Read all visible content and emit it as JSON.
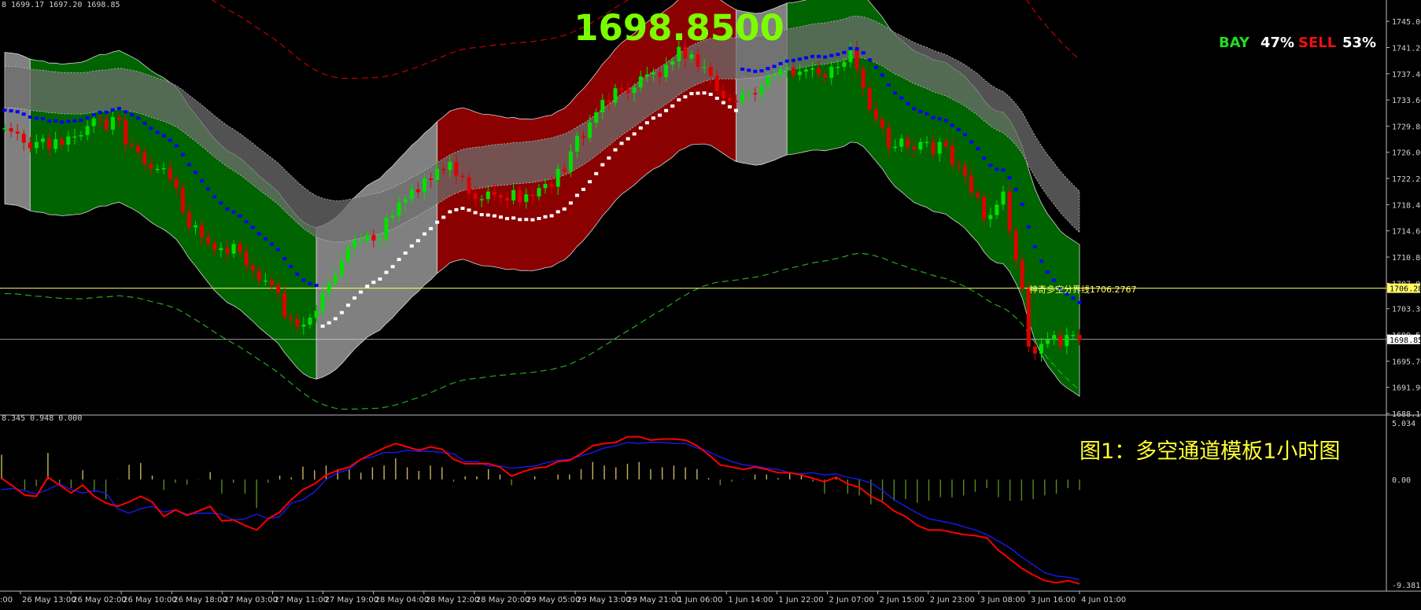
{
  "ohlc_header": "8 1699.17 1697.20 1698.85",
  "big_price": "1698.8500",
  "bay_label": "BAY",
  "bay_pct": "47%",
  "sell_label": "SELL",
  "sell_pct": "53%",
  "boundary_label": "神奇多空分界线1706.2767",
  "figure_caption": "图1：多空通道模板1小时图",
  "indicator_header": "8.345 0.948 0.000",
  "colors": {
    "bull_band": "#006400",
    "bear_band": "#8b0000",
    "neutral_band": "#808080",
    "up_candle": "#00e000",
    "down_candle": "#e00000",
    "trend_blue": "#0000ff",
    "trend_white": "#ffffff",
    "boundary_line": "#ffff66",
    "macd_red": "#ff0000",
    "macd_blue": "#1a1aff",
    "hist_pos": "#c8b464",
    "hist_neg": "#5a8a1e",
    "title_green": "#7cfc00",
    "caption_yellow": "#ffff33"
  },
  "chart_data": [
    {
      "type": "candlestick",
      "title": "1698.8500",
      "price_axis_ticks": [
        "1745.00",
        "1741.20",
        "1737.40",
        "1733.60",
        "1729.80",
        "1726.00",
        "1722.20",
        "1718.40",
        "1714.60",
        "1710.80",
        "1707.00",
        "1703.30",
        "1699.50",
        "1695.70",
        "1691.90",
        "1688.10"
      ],
      "price_markers": [
        {
          "label": "1706.28",
          "value": 1706.28
        },
        {
          "label": "1698.85",
          "value": 1698.85
        }
      ],
      "ylim": [
        1688.1,
        1746.5
      ],
      "time_axis_ticks": [
        "26 May 13:00",
        "26 May 02:00",
        "26 May 10:00",
        "26 May 18:00",
        "27 May 03:00",
        "27 May 11:00",
        "27 May 19:00",
        "28 May 04:00",
        "28 May 12:00",
        "28 May 20:00",
        "29 May 05:00",
        "29 May 13:00",
        "29 May 21:00",
        "1 Jun 06:00",
        "1 Jun 14:00",
        "1 Jun 22:00",
        "2 Jun 07:00",
        "2 Jun 15:00",
        "2 Jun 23:00",
        "3 Jun 08:00",
        "3 Jun 16:00",
        "4 Jun 01:00"
      ],
      "first_tick_partial": ":00",
      "close_series": [
        1729.5,
        1729.0,
        1728.7,
        1727.4,
        1726.6,
        1727.5,
        1728.0,
        1726.5,
        1727.9,
        1727.1,
        1728.3,
        1728.3,
        1728.5,
        1729.8,
        1730.9,
        1730.8,
        1729.3,
        1731.1,
        1730.7,
        1727.1,
        1726.9,
        1726.0,
        1724.3,
        1723.6,
        1723.6,
        1723.7,
        1722.1,
        1720.8,
        1717.3,
        1715.1,
        1715.4,
        1713.7,
        1712.8,
        1711.8,
        1712.1,
        1711.3,
        1712.7,
        1711.5,
        1709.6,
        1708.8,
        1707.4,
        1707.4,
        1706.7,
        1705.6,
        1702.1,
        1701.8,
        1700.7,
        1701.0,
        1702.0,
        1703.0,
        1705.6,
        1707.0,
        1708.2,
        1710.3,
        1712.2,
        1713.2,
        1713.2,
        1714.0,
        1713.2,
        1713.4,
        1716.5,
        1716.8,
        1718.7,
        1719.2,
        1720.6,
        1720.2,
        1722.2,
        1722.0,
        1723.6,
        1723.4,
        1724.6,
        1722.6,
        1722.4,
        1720.0,
        1719.2,
        1719.2,
        1720.3,
        1719.8,
        1719.4,
        1719.0,
        1720.5,
        1718.8,
        1719.9,
        1719.6,
        1720.8,
        1721.4,
        1721.0,
        1723.6,
        1723.2,
        1726.1,
        1728.4,
        1728.1,
        1730.3,
        1731.8,
        1733.6,
        1733.2,
        1735.3,
        1735.1,
        1734.6,
        1735.4,
        1737.0,
        1737.3,
        1737.6,
        1736.9,
        1738.7,
        1739.2,
        1741.3,
        1739.6,
        1740.2,
        1738.4,
        1738.4,
        1737.1,
        1734.9,
        1733.9,
        1733.5,
        1733.3,
        1734.5,
        1734.6,
        1734.4,
        1735.6,
        1737.0,
        1737.3,
        1738.1,
        1738.3,
        1737.2,
        1737.7,
        1738.0,
        1738.2,
        1737.3,
        1736.8,
        1738.4,
        1738.4,
        1739.1,
        1741.1,
        1738.1,
        1735.3,
        1732.2,
        1730.8,
        1729.6,
        1726.7,
        1726.8,
        1728.0,
        1726.8,
        1726.4,
        1727.5,
        1727.5,
        1725.8,
        1727.5,
        1726.9,
        1724.2,
        1724.0,
        1722.6,
        1720.1,
        1719.5,
        1716.3,
        1716.9,
        1718.4,
        1720.3,
        1714.6,
        1710.3,
        1706.2,
        1697.8,
        1696.8,
        1698.2,
        1698.8,
        1699.5,
        1697.9,
        1699.5,
        1699.5,
        1698.8
      ]
    },
    {
      "type": "line",
      "title": "",
      "header": "8.345 0.948 0.000",
      "axis_ticks": [
        "5.034",
        "0.00",
        "-9.381"
      ],
      "ylim": [
        -9.381,
        5.034
      ],
      "series": [
        {
          "color": "red",
          "values": [
            0.1,
            -0.6,
            -1.4,
            -1.5,
            0.2,
            -0.5,
            -1.2,
            -0.5,
            -1.5,
            -2.1,
            -2.4,
            -2.0,
            -1.5,
            -2.0,
            -3.3,
            -2.7,
            -3.2,
            -2.8,
            -2.4,
            -3.7,
            -3.6,
            -4.1,
            -4.5,
            -3.5,
            -2.9,
            -1.8,
            -0.9,
            -0.4,
            0.4,
            0.8,
            1.1,
            1.8,
            2.3,
            2.8,
            3.2,
            2.9,
            2.6,
            2.9,
            2.7,
            1.8,
            1.4,
            1.4,
            1.4,
            1.1,
            0.3,
            0.7,
            1.0,
            1.1,
            1.6,
            1.7,
            2.3,
            3.0,
            3.2,
            3.3,
            3.8,
            3.8,
            3.5,
            3.6,
            3.6,
            3.5,
            3.0,
            2.2,
            1.3,
            1.1,
            0.9,
            1.1,
            0.9,
            0.6,
            0.6,
            0.4,
            0.1,
            -0.2,
            0.2,
            -0.4,
            -0.7,
            -1.5,
            -2.0,
            -2.8,
            -3.3,
            -4.1,
            -4.5,
            -4.5,
            -4.7,
            -4.9,
            -5.0,
            -5.2,
            -6.3,
            -7.1,
            -7.9,
            -8.5,
            -9.0,
            -9.2,
            -9.0,
            -9.3
          ]
        },
        {
          "color": "blue",
          "values": [
            -0.9,
            -0.8,
            -1.0,
            -1.3,
            -0.9,
            -0.4,
            -0.9,
            -1.2,
            -1.0,
            -1.2,
            -2.6,
            -3.0,
            -2.6,
            -2.4,
            -2.9,
            -2.7,
            -3.1,
            -3.0,
            -3.0,
            -3.1,
            -3.6,
            -3.5,
            -3.1,
            -3.5,
            -3.3,
            -2.1,
            -1.8,
            -1.1,
            0.0,
            0.6,
            0.9,
            1.8,
            2.0,
            2.4,
            2.4,
            2.6,
            2.5,
            2.5,
            2.4,
            2.3,
            1.6,
            1.6,
            1.2,
            1.2,
            1.0,
            1.1,
            1.2,
            1.5,
            1.7,
            1.8,
            2.1,
            2.4,
            2.8,
            3.0,
            3.3,
            3.2,
            3.3,
            3.3,
            3.2,
            3.2,
            2.8,
            2.5,
            2.0,
            1.6,
            1.3,
            1.2,
            1.0,
            0.9,
            0.6,
            0.5,
            0.6,
            0.4,
            0.5,
            0.2,
            0.0,
            -0.3,
            -1.0,
            -1.8,
            -2.4,
            -3.0,
            -3.5,
            -3.7,
            -3.9,
            -4.2,
            -4.5,
            -4.9,
            -5.5,
            -6.1,
            -6.9,
            -7.6,
            -8.3,
            -8.6,
            -8.7,
            -8.9
          ]
        }
      ]
    }
  ]
}
